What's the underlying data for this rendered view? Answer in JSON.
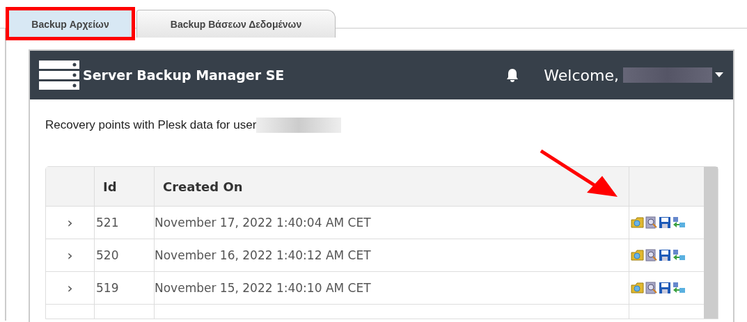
{
  "tabs": [
    {
      "label": "Backup Αρχείων",
      "selected": true
    },
    {
      "label": "Backup Βάσεων Δεδομένων",
      "selected": false
    }
  ],
  "header": {
    "title": "Server Backup Manager SE",
    "welcome": "Welcome,"
  },
  "intro": "Recovery points with Plesk data for user",
  "table": {
    "columns": [
      "Id",
      "Created On"
    ],
    "rows": [
      {
        "expander": "›",
        "id": "521",
        "created_on": "November 17, 2022 1:40:04 AM CET"
      },
      {
        "expander": "›",
        "id": "520",
        "created_on": "November 16, 2022 1:40:12 AM CET"
      },
      {
        "expander": "›",
        "id": "519",
        "created_on": "November 15, 2022 1:40:10 AM CET"
      }
    ]
  }
}
